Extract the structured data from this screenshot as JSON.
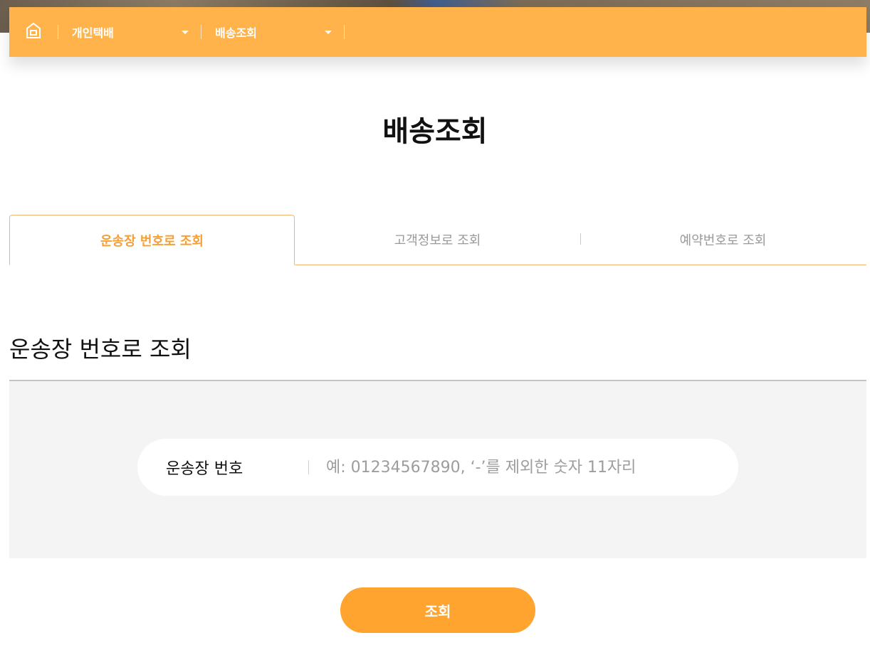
{
  "colors": {
    "accent": "#ffb34a",
    "button": "#ffa42f",
    "active_tab_text": "#f59f36",
    "form_background": "#f4f4f4"
  },
  "nav": {
    "home_icon": "home-icon",
    "menu1": {
      "label": "개인택배",
      "icon": "caret-down-icon"
    },
    "menu2": {
      "label": "배송조회",
      "icon": "caret-down-icon"
    }
  },
  "page": {
    "title": "배송조회"
  },
  "tabs": [
    {
      "label": "운송장 번호로 조회",
      "active": true
    },
    {
      "label": "고객정보로 조회",
      "active": false
    },
    {
      "label": "예약번호로 조회",
      "active": false
    }
  ],
  "section": {
    "title": "운송장 번호로 조회"
  },
  "form": {
    "label": "운송장 번호",
    "value": "",
    "placeholder": "예: 01234567890, ‘-’를 제외한 숫자 11자리"
  },
  "submit": {
    "label": "조회"
  }
}
